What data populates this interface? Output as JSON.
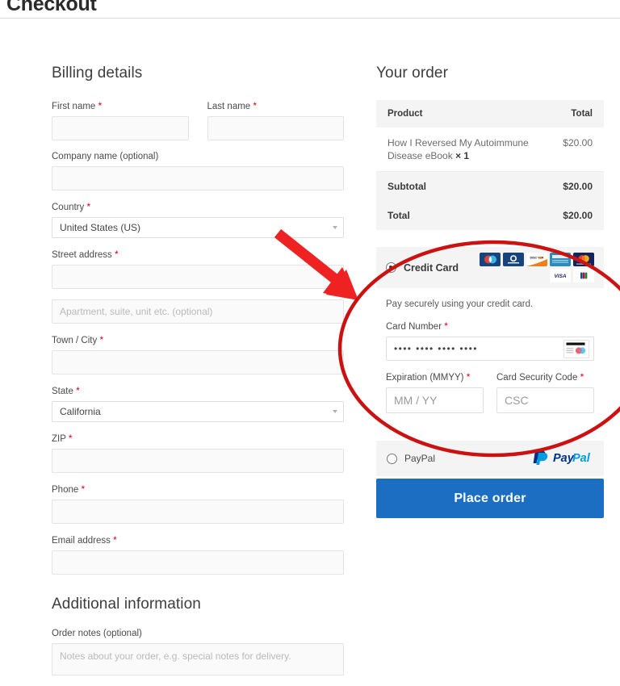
{
  "page": {
    "title": "Checkout"
  },
  "billing": {
    "heading": "Billing details",
    "fields": [
      {
        "label": "First name",
        "required": true,
        "value": "",
        "placeholder": ""
      },
      {
        "label": "Last name",
        "required": true,
        "value": "",
        "placeholder": ""
      },
      {
        "label": "Company name (optional)",
        "required": false,
        "value": "",
        "placeholder": ""
      },
      {
        "label": "Country",
        "required": true,
        "value": "United States (US)",
        "placeholder": ""
      },
      {
        "label": "Street address",
        "required": true,
        "value": "",
        "placeholder": ""
      },
      {
        "label": "",
        "required": false,
        "value": "",
        "placeholder": "Apartment, suite, unit etc. (optional)"
      },
      {
        "label": "Town / City",
        "required": true,
        "value": "",
        "placeholder": ""
      },
      {
        "label": "State",
        "required": true,
        "value": "California",
        "placeholder": ""
      },
      {
        "label": "ZIP",
        "required": true,
        "value": "",
        "placeholder": ""
      },
      {
        "label": "Phone",
        "required": true,
        "value": "",
        "placeholder": ""
      },
      {
        "label": "Email address",
        "required": true,
        "value": "",
        "placeholder": ""
      }
    ]
  },
  "additional": {
    "heading": "Additional information",
    "notes_label": "Order notes (optional)",
    "notes_placeholder": "Notes about your order, e.g. special notes for delivery.",
    "notes_value": ""
  },
  "order": {
    "heading": "Your order",
    "columns": [
      "Product",
      "Total"
    ],
    "items": [
      {
        "name": "How I Reversed My Autoimmune Disease eBook",
        "qty": "× 1",
        "total": "$20.00"
      }
    ],
    "totals": [
      {
        "label": "Subtotal",
        "value": "$20.00"
      },
      {
        "label": "Total",
        "value": "$20.00"
      }
    ]
  },
  "payment": {
    "credit_card": {
      "label": "Credit Card",
      "selected": true,
      "card_logos": [
        "maestro-logo",
        "diners-club-logo",
        "discover-logo",
        "jcb-logo",
        "mastercard-logo",
        "visa-logo",
        "jcb-square-logo"
      ],
      "note": "Pay securely using your credit card.",
      "card_number_label": "Card Number",
      "card_number_required": true,
      "card_number_value": "•••• •••• •••• ••••",
      "card_brand_icon": "credit-card-icon",
      "expiration_label": "Expiration (MMYY)",
      "expiration_required": true,
      "expiration_placeholder": "MM / YY",
      "expiration_value": "",
      "csc_label": "Card Security Code",
      "csc_required": true,
      "csc_placeholder": "CSC",
      "csc_value": ""
    },
    "paypal": {
      "label": "PayPal",
      "selected": false,
      "logo": "paypal-logo"
    },
    "place_order_label": "Place order"
  },
  "annotations": {
    "arrow_color": "#ee2222",
    "ellipse_color": "#cc1111",
    "arrow": "red-arrow-pointing-to-credit-card-section",
    "ellipse": "red-ellipse-around-credit-card-form"
  },
  "colors": {
    "accent_button": "#1b6ec2",
    "required_star": "#d0021b",
    "table_header_bg": "#f4f4f4"
  }
}
